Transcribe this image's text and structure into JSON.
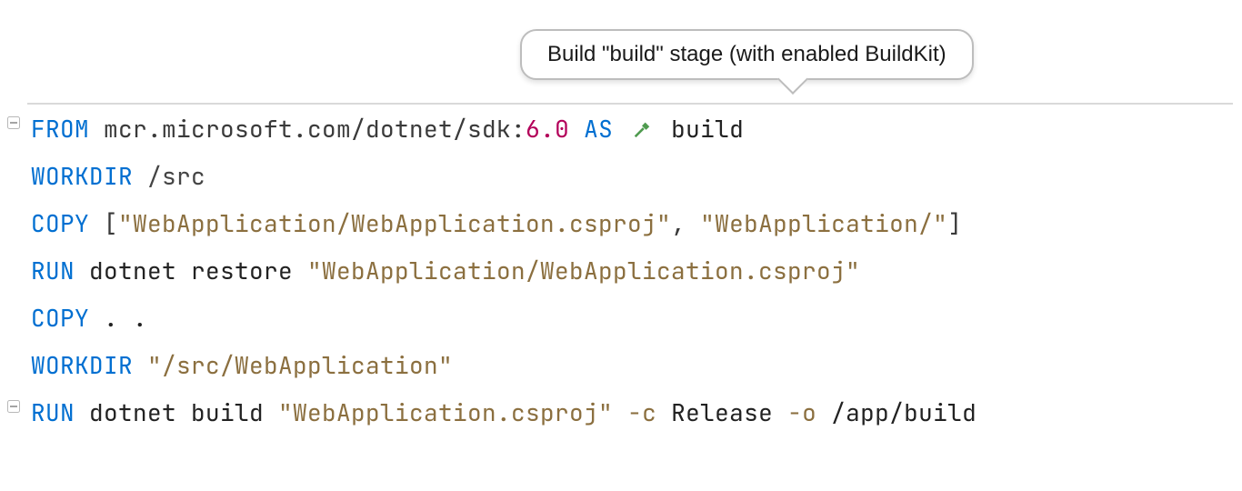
{
  "tooltip": {
    "text": "Build \"build\" stage (with enabled BuildKit)"
  },
  "icons": {
    "hammer": "hammer-icon",
    "fold1": "fold-collapse-icon",
    "fold2": "fold-collapse-icon"
  },
  "lines": {
    "l1": {
      "from": "FROM",
      "image": "mcr.microsoft.com/dotnet/sdk",
      "colon": ":",
      "ver": "6.0",
      "as": "AS",
      "stage": "build"
    },
    "l2": {
      "kw": "WORKDIR",
      "path": "/src"
    },
    "l3": {
      "kw": "COPY",
      "lb": "[",
      "a": "\"WebApplication/WebApplication.csproj\"",
      "comma": ", ",
      "b": "\"WebApplication/\"",
      "rb": "]"
    },
    "l4": {
      "kw": "RUN",
      "cmd": "dotnet restore ",
      "str": "\"WebApplication/WebApplication.csproj\""
    },
    "l5": {
      "kw": "COPY",
      "rest": " . ."
    },
    "l6": {
      "kw": "WORKDIR",
      "str": "\"/src/WebApplication\""
    },
    "l7": {
      "kw": "RUN",
      "cmd": "dotnet build ",
      "str": "\"WebApplication.csproj\"",
      "f1": " -c",
      "v1": " Release",
      "f2": " -o",
      "v2": " /app/build"
    }
  }
}
